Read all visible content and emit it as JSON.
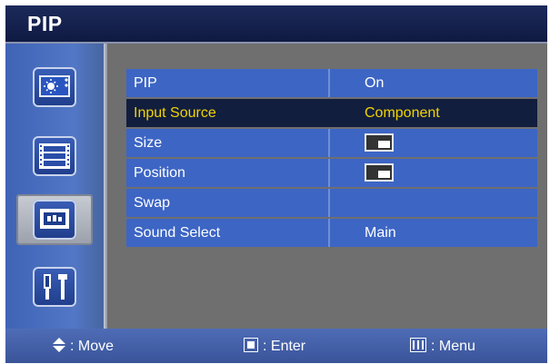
{
  "window": {
    "title": "PIP"
  },
  "sidebar": {
    "tabs": [
      {
        "icon": "picture-icon"
      },
      {
        "icon": "film-icon"
      },
      {
        "icon": "pip-screen-icon",
        "active": true
      },
      {
        "icon": "tools-icon"
      }
    ]
  },
  "menu": {
    "rows": [
      {
        "label": "PIP",
        "value": "On"
      },
      {
        "label": "Input Source",
        "value": "Component",
        "selected": true
      },
      {
        "label": "Size",
        "value": "",
        "value_icon": "pip-size-icon"
      },
      {
        "label": "Position",
        "value": "",
        "value_icon": "pip-position-icon"
      },
      {
        "label": "Swap",
        "value": ""
      },
      {
        "label": "Sound Select",
        "value": "Main"
      }
    ]
  },
  "help": {
    "move": ": Move",
    "enter": ": Enter",
    "menu": ": Menu"
  },
  "colors": {
    "row_bg": "#3d65c4",
    "selected_bg": "#121e3e",
    "selected_text": "#f1d400",
    "title_bg": "#1c2a5a",
    "content_bg": "#6f6f6f"
  }
}
